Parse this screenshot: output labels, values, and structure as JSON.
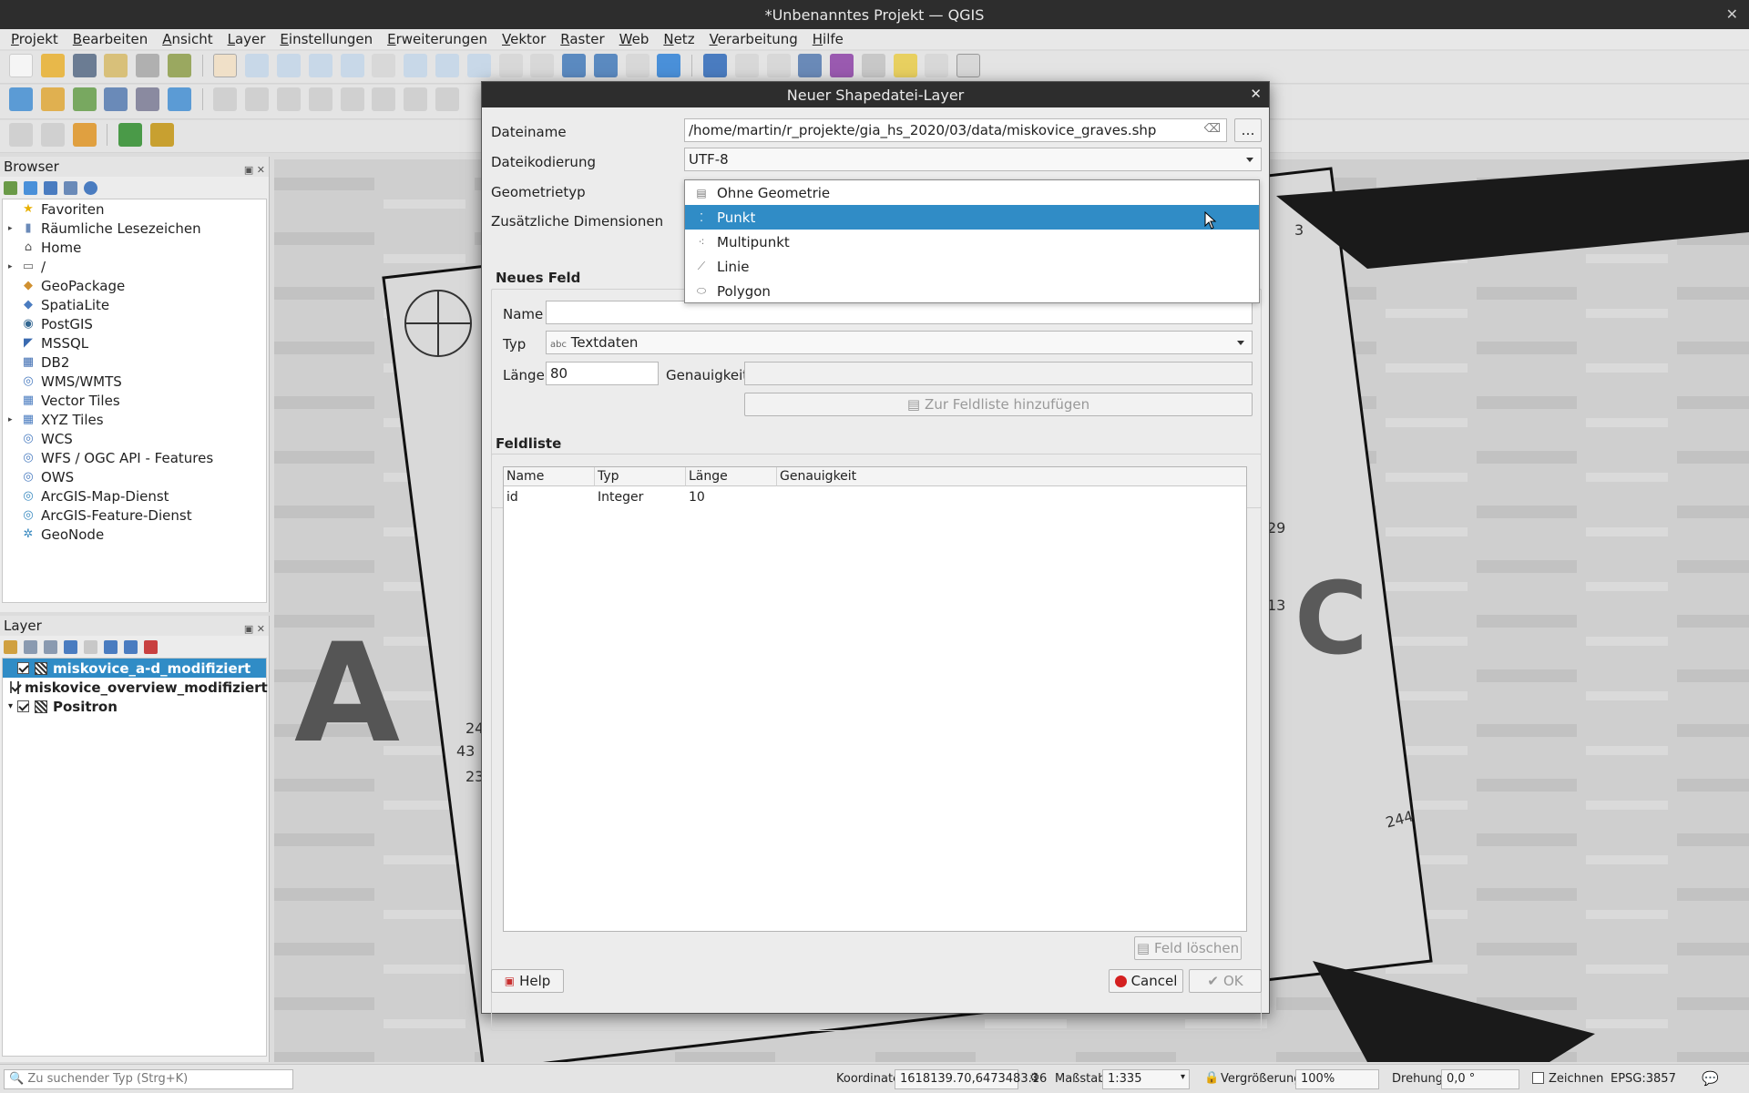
{
  "window": {
    "title": "*Unbenanntes Projekt — QGIS"
  },
  "menu": [
    "Projekt",
    "Bearbeiten",
    "Ansicht",
    "Layer",
    "Einstellungen",
    "Erweiterungen",
    "Vektor",
    "Raster",
    "Web",
    "Netz",
    "Verarbeitung",
    "Hilfe"
  ],
  "browser": {
    "title": "Browser",
    "items": [
      {
        "label": "Favoriten",
        "icon": "star-icon",
        "arrow": ""
      },
      {
        "label": "Räumliche Lesezeichen",
        "icon": "bookmark-icon",
        "arrow": "▸"
      },
      {
        "label": "Home",
        "icon": "home-folder-icon",
        "arrow": ""
      },
      {
        "label": "/",
        "icon": "folder-icon",
        "arrow": "▸"
      },
      {
        "label": "GeoPackage",
        "icon": "geopackage-icon",
        "arrow": ""
      },
      {
        "label": "SpatiaLite",
        "icon": "spatialite-icon",
        "arrow": ""
      },
      {
        "label": "PostGIS",
        "icon": "postgis-icon",
        "arrow": ""
      },
      {
        "label": "MSSQL",
        "icon": "mssql-icon",
        "arrow": ""
      },
      {
        "label": "DB2",
        "icon": "db2-icon",
        "arrow": ""
      },
      {
        "label": "WMS/WMTS",
        "icon": "wms-icon",
        "arrow": ""
      },
      {
        "label": "Vector Tiles",
        "icon": "vector-tiles-icon",
        "arrow": ""
      },
      {
        "label": "XYZ Tiles",
        "icon": "xyz-tiles-icon",
        "arrow": "▸"
      },
      {
        "label": "WCS",
        "icon": "wcs-icon",
        "arrow": ""
      },
      {
        "label": "WFS / OGC API - Features",
        "icon": "wfs-icon",
        "arrow": ""
      },
      {
        "label": "OWS",
        "icon": "ows-icon",
        "arrow": ""
      },
      {
        "label": "ArcGIS-Map-Dienst",
        "icon": "arcgis-map-icon",
        "arrow": ""
      },
      {
        "label": "ArcGIS-Feature-Dienst",
        "icon": "arcgis-feature-icon",
        "arrow": ""
      },
      {
        "label": "GeoNode",
        "icon": "geonode-icon",
        "arrow": ""
      }
    ]
  },
  "layers": {
    "title": "Layer",
    "items": [
      {
        "label": "miskovice_a-d_modifiziert",
        "selected": true,
        "arrow": ""
      },
      {
        "label": "miskovice_overview_modifiziert",
        "selected": false,
        "arrow": ""
      },
      {
        "label": "Positron",
        "selected": false,
        "arrow": "▾"
      }
    ]
  },
  "dialog": {
    "title": "Neuer Shapedatei-Layer",
    "filename_label": "Dateiname",
    "filename_value": "/home/martin/r_projekte/gia_hs_2020/03/data/miskovice_graves.shp",
    "browse_label": "…",
    "encoding_label": "Dateikodierung",
    "encoding_value": "UTF-8",
    "geometry_label": "Geometrietyp",
    "dimensions_label": "Zusätzliche Dimensionen",
    "geometry_options": [
      {
        "label": "Ohne Geometrie",
        "icon": "table-icon",
        "selected": false
      },
      {
        "label": "Punkt",
        "icon": "point-icon",
        "selected": true
      },
      {
        "label": "Multipunkt",
        "icon": "multipoint-icon",
        "selected": false
      },
      {
        "label": "Linie",
        "icon": "line-icon",
        "selected": false
      },
      {
        "label": "Polygon",
        "icon": "polygon-icon",
        "selected": false
      }
    ],
    "new_field": {
      "title": "Neues Feld",
      "name_label": "Name",
      "name_value": "",
      "type_label": "Typ",
      "type_icon_text": "abc",
      "type_value": "Textdaten",
      "length_label": "Länge",
      "length_value": "80",
      "precision_label": "Genauigkeit",
      "precision_value": "",
      "add_button": "Zur Feldliste hinzufügen"
    },
    "field_list": {
      "title": "Feldliste",
      "columns": [
        "Name",
        "Typ",
        "Länge",
        "Genauigkeit"
      ],
      "rows": [
        {
          "name": "id",
          "type": "Integer",
          "length": "10",
          "precision": ""
        }
      ],
      "delete_button": "Feld löschen"
    },
    "help_button": "Help",
    "cancel_button": "Cancel",
    "ok_button": "OK"
  },
  "statusbar": {
    "search_placeholder": "Zu suchender Typ (Strg+K)",
    "coordinate_label": "Koordinate",
    "coordinate_value": "1618139.70,6473483.16",
    "scale_label": "Maßstab",
    "scale_value": "1:335",
    "magnifier_label": "Vergrößerung",
    "magnifier_value": "100%",
    "rotation_label": "Drehung",
    "rotation_value": "0,0 °",
    "render_label": "Zeichnen",
    "crs_value": "EPSG:3857"
  },
  "map_labels": {
    "letter_a": "A",
    "letter_c": "C",
    "n1": "29",
    "n2": "13",
    "n3": "244",
    "n4": "24",
    "n5": "43",
    "n6": "23",
    "n7": "3"
  },
  "colors": {
    "accent": "#308cc6",
    "titlebar": "#2d2d2d"
  }
}
